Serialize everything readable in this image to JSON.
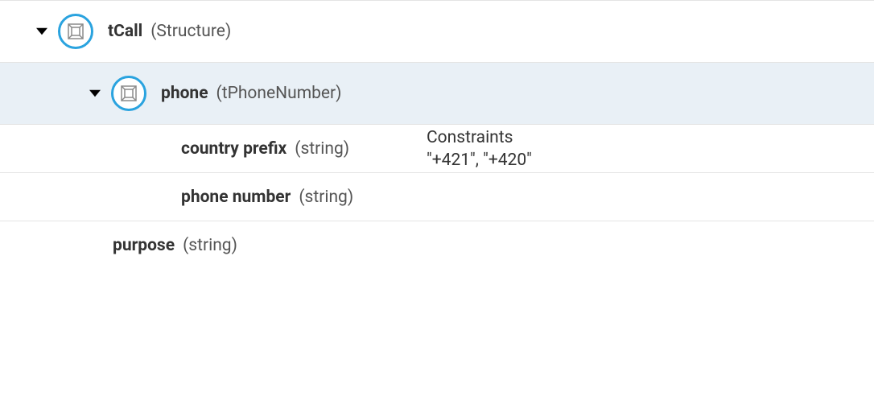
{
  "tree": {
    "root": {
      "name": "tCall",
      "type": "Structure"
    },
    "phone": {
      "name": "phone",
      "type": "tPhoneNumber"
    },
    "countryPrefix": {
      "name": "country prefix",
      "type": "string",
      "constraints_label": "Constraints",
      "constraints_value": "\"+421\", \"+420\""
    },
    "phoneNumber": {
      "name": "phone number",
      "type": "string"
    },
    "purpose": {
      "name": "purpose",
      "type": "string"
    }
  }
}
